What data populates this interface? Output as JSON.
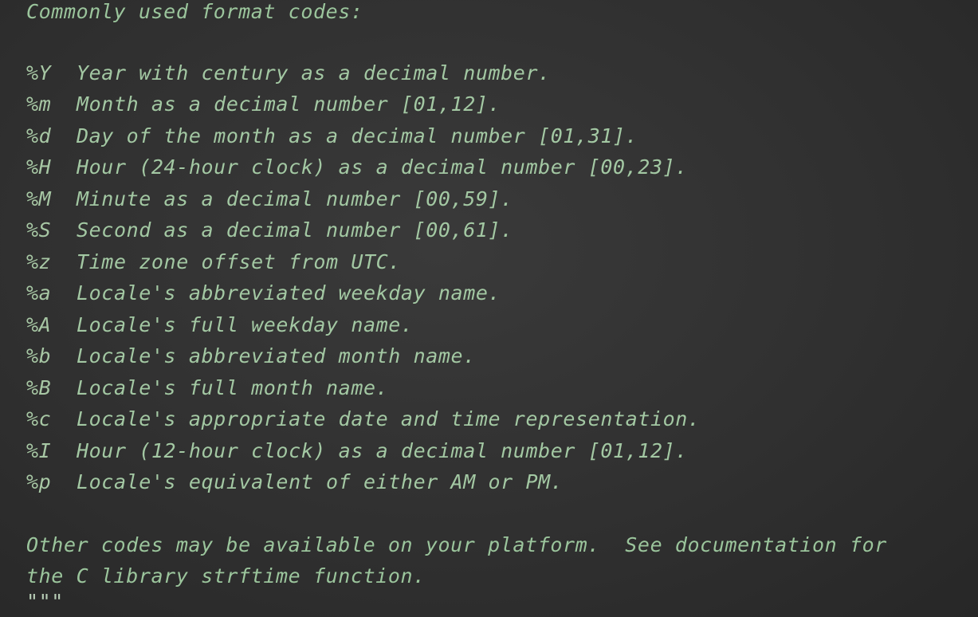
{
  "doc": {
    "heading": "Commonly used format codes:",
    "codes": [
      {
        "code": "%Y",
        "desc": "Year with century as a decimal number."
      },
      {
        "code": "%m",
        "desc": "Month as a decimal number [01,12]."
      },
      {
        "code": "%d",
        "desc": "Day of the month as a decimal number [01,31]."
      },
      {
        "code": "%H",
        "desc": "Hour (24-hour clock) as a decimal number [00,23]."
      },
      {
        "code": "%M",
        "desc": "Minute as a decimal number [00,59]."
      },
      {
        "code": "%S",
        "desc": "Second as a decimal number [00,61]."
      },
      {
        "code": "%z",
        "desc": "Time zone offset from UTC."
      },
      {
        "code": "%a",
        "desc": "Locale's abbreviated weekday name."
      },
      {
        "code": "%A",
        "desc": "Locale's full weekday name."
      },
      {
        "code": "%b",
        "desc": "Locale's abbreviated month name."
      },
      {
        "code": "%B",
        "desc": "Locale's full month name."
      },
      {
        "code": "%c",
        "desc": "Locale's appropriate date and time representation."
      },
      {
        "code": "%I",
        "desc": "Hour (12-hour clock) as a decimal number [01,12]."
      },
      {
        "code": "%p",
        "desc": "Locale's equivalent of either AM or PM."
      }
    ],
    "footer_line1": "Other codes may be available on your platform.  See documentation for",
    "footer_line2": "the C library strftime function.",
    "docstring_close": "\"\"\""
  },
  "colors": {
    "background": "#303030",
    "text": "#9bc59c"
  }
}
